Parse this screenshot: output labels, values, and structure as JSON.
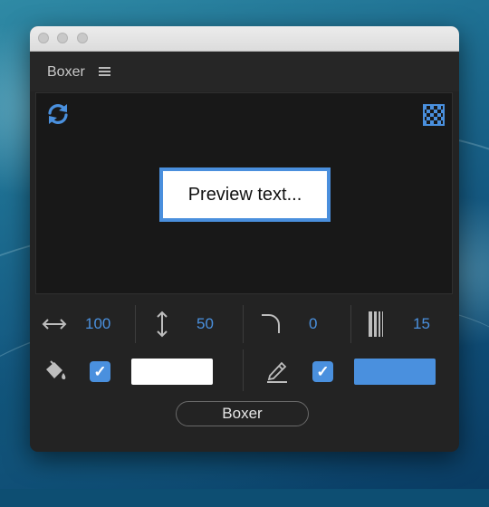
{
  "panel": {
    "title": "Boxer",
    "menu_icon": "hamburger-menu-icon"
  },
  "preview": {
    "text": "Preview text...",
    "refresh_icon": "refresh-icon",
    "transparency_icon": "checkerboard-icon",
    "box_fill_color": "#ffffff",
    "box_stroke_color": "#4a8fdd"
  },
  "controls": {
    "width": {
      "icon": "horizontal-resize-icon",
      "value": "100"
    },
    "height": {
      "icon": "vertical-resize-icon",
      "value": "50"
    },
    "corner_radius": {
      "icon": "corner-radius-icon",
      "value": "0"
    },
    "stroke_width": {
      "icon": "stroke-width-icon",
      "value": "15"
    },
    "fill": {
      "icon": "paint-bucket-icon",
      "enabled": true,
      "check": "✓",
      "color": "#ffffff"
    },
    "stroke": {
      "icon": "pen-icon",
      "enabled": true,
      "check": "✓",
      "color": "#4a90de"
    }
  },
  "action_button": {
    "label": "Boxer"
  },
  "colors": {
    "accent": "#4a90de",
    "panel_bg": "#232323",
    "preview_bg": "#181818"
  }
}
